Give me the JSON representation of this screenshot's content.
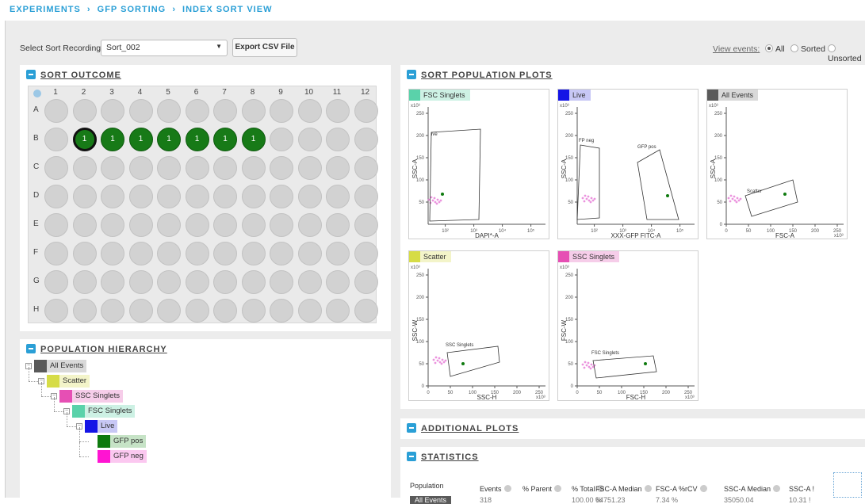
{
  "breadcrumb": [
    "EXPERIMENTS",
    "GFP SORTING",
    "INDEX SORT VIEW"
  ],
  "breadcrumb_sep": "›",
  "toolbar": {
    "select_label": "Select Sort Recording:",
    "select_value": "Sort_002",
    "export_label": "Export CSV File",
    "view_events_label": "View events:",
    "view_options": [
      "All",
      "Sorted",
      "Unsorted"
    ],
    "view_selected": "All"
  },
  "sort_outcome": {
    "title": "SORT OUTCOME",
    "columns": [
      "1",
      "2",
      "3",
      "4",
      "5",
      "6",
      "7",
      "8",
      "9",
      "10",
      "11",
      "12"
    ],
    "rows": [
      "A",
      "B",
      "C",
      "D",
      "E",
      "F",
      "G",
      "H"
    ],
    "sorted_wells": [
      {
        "row": "B",
        "col": 2,
        "value": "1",
        "selected": true
      },
      {
        "row": "B",
        "col": 3,
        "value": "1"
      },
      {
        "row": "B",
        "col": 4,
        "value": "1"
      },
      {
        "row": "B",
        "col": 5,
        "value": "1"
      },
      {
        "row": "B",
        "col": 6,
        "value": "1"
      },
      {
        "row": "B",
        "col": 7,
        "value": "1"
      },
      {
        "row": "B",
        "col": 8,
        "value": "1"
      }
    ],
    "sorted_color": "#177a17"
  },
  "hierarchy": {
    "title": "POPULATION HIERARCHY",
    "nodes": [
      {
        "label": "All Events",
        "color": "#5a5a5a",
        "bg": "#d9d9d9",
        "depth": 0
      },
      {
        "label": "Scatter",
        "color": "#d6dc46",
        "bg": "#f3f4c9",
        "depth": 1
      },
      {
        "label": "SSC Singlets",
        "color": "#e64fb4",
        "bg": "#f6cde9",
        "depth": 2
      },
      {
        "label": "FSC Singlets",
        "color": "#5ad2aa",
        "bg": "#cdf1e4",
        "depth": 3
      },
      {
        "label": "Live",
        "color": "#1414e6",
        "bg": "#c8c8f5",
        "depth": 4
      },
      {
        "label": "GFP pos",
        "color": "#0e7a0e",
        "bg": "#c6e3c6",
        "depth": 5
      },
      {
        "label": "GFP neg",
        "color": "#ff14d2",
        "bg": "#fbc8f0",
        "depth": 5
      }
    ]
  },
  "plots_title": "SORT POPULATION PLOTS",
  "plots": [
    {
      "name": "FSC Singlets",
      "color": "#5ad2aa",
      "bg": "#cdf1e4",
      "xlabel": "DAPI*-A",
      "ylabel": "SSC-A",
      "xticks": [
        "10²",
        "10³",
        "10⁴",
        "10⁵"
      ],
      "yticks": [
        "50",
        "100",
        "150",
        "200",
        "250"
      ],
      "ymult": "x10³",
      "gates": [
        "ive"
      ]
    },
    {
      "name": "Live",
      "color": "#1414e6",
      "bg": "#c8c8f5",
      "xlabel": "XXX-GFP FITC-A",
      "ylabel": "SSC-A",
      "xticks": [
        "10²",
        "10³",
        "10⁴",
        "10⁵"
      ],
      "yticks": [
        "50",
        "100",
        "150",
        "200",
        "250"
      ],
      "ymult": "x10³",
      "gates": [
        "FP neg",
        "GFP pos"
      ]
    },
    {
      "name": "All Events",
      "color": "#5a5a5a",
      "bg": "#d9d9d9",
      "xlabel": "FSC-A",
      "ylabel": "SSC-A",
      "xticks": [
        "0",
        "50",
        "100",
        "150",
        "200",
        "250"
      ],
      "yticks": [
        "0",
        "50",
        "100",
        "150",
        "200",
        "250"
      ],
      "ymult": "x10³",
      "xmult": "x10³",
      "gates": [
        "Scatter"
      ]
    },
    {
      "name": "Scatter",
      "color": "#d6dc46",
      "bg": "#f3f4c9",
      "xlabel": "SSC-H",
      "ylabel": "SSC-W",
      "xticks": [
        "0",
        "50",
        "100",
        "150",
        "200",
        "250"
      ],
      "yticks": [
        "0",
        "50",
        "100",
        "150",
        "200",
        "250"
      ],
      "ymult": "x10³",
      "xmult": "x10³",
      "gates": [
        "SSC Singlets"
      ]
    },
    {
      "name": "SSC Singlets",
      "color": "#e64fb4",
      "bg": "#f6cde9",
      "xlabel": "FSC-H",
      "ylabel": "FSC-W",
      "xticks": [
        "0",
        "50",
        "100",
        "150",
        "200",
        "250"
      ],
      "yticks": [
        "0",
        "50",
        "100",
        "150",
        "200",
        "250"
      ],
      "ymult": "x10³",
      "xmult": "x10³",
      "gates": [
        "FSC Singlets"
      ]
    }
  ],
  "additional_plots_title": "ADDITIONAL PLOTS",
  "statistics": {
    "title": "STATISTICS",
    "columns": [
      "Population",
      "Events",
      "% Parent",
      "% Total",
      "FSC-A Median",
      "FSC-A %rCV",
      "SSC-A Median",
      "SSC-A !"
    ],
    "first_row": [
      "All Events",
      "318",
      "",
      "100.00 %",
      "64751.23",
      "7.34 %",
      "35050.04",
      "10.31 !"
    ]
  }
}
